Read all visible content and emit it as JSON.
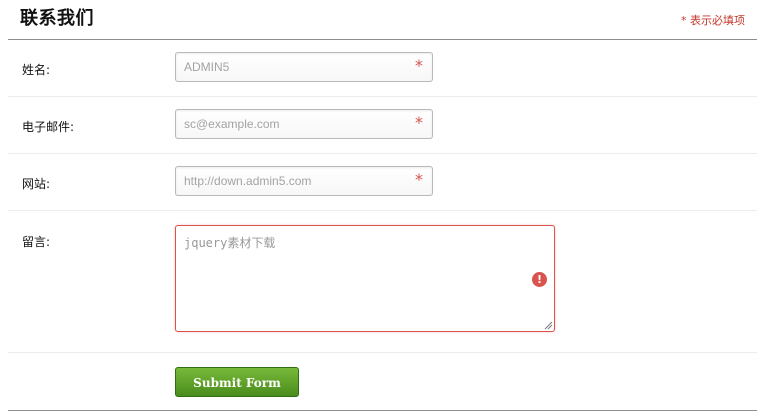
{
  "header": {
    "title": "联系我们",
    "required_note": "* 表示必填项"
  },
  "form": {
    "fields": [
      {
        "label": "姓名:",
        "placeholder": "ADMIN5",
        "required_mark": "*"
      },
      {
        "label": "电子邮件:",
        "placeholder": "sc@example.com",
        "required_mark": "*"
      },
      {
        "label": "网站:",
        "placeholder": "http://down.admin5.com",
        "required_mark": "*"
      }
    ],
    "message": {
      "label": "留言:",
      "placeholder": "jquery素材下载",
      "status": "error"
    },
    "submit_label": "Submit Form"
  },
  "colors": {
    "required": "#d9534f",
    "submit_button": "#5ca12c",
    "error_border": "#d9534f"
  },
  "icons": {
    "message_error": "exclamation-circle-icon",
    "textarea_resize": "resize-grip-icon"
  }
}
